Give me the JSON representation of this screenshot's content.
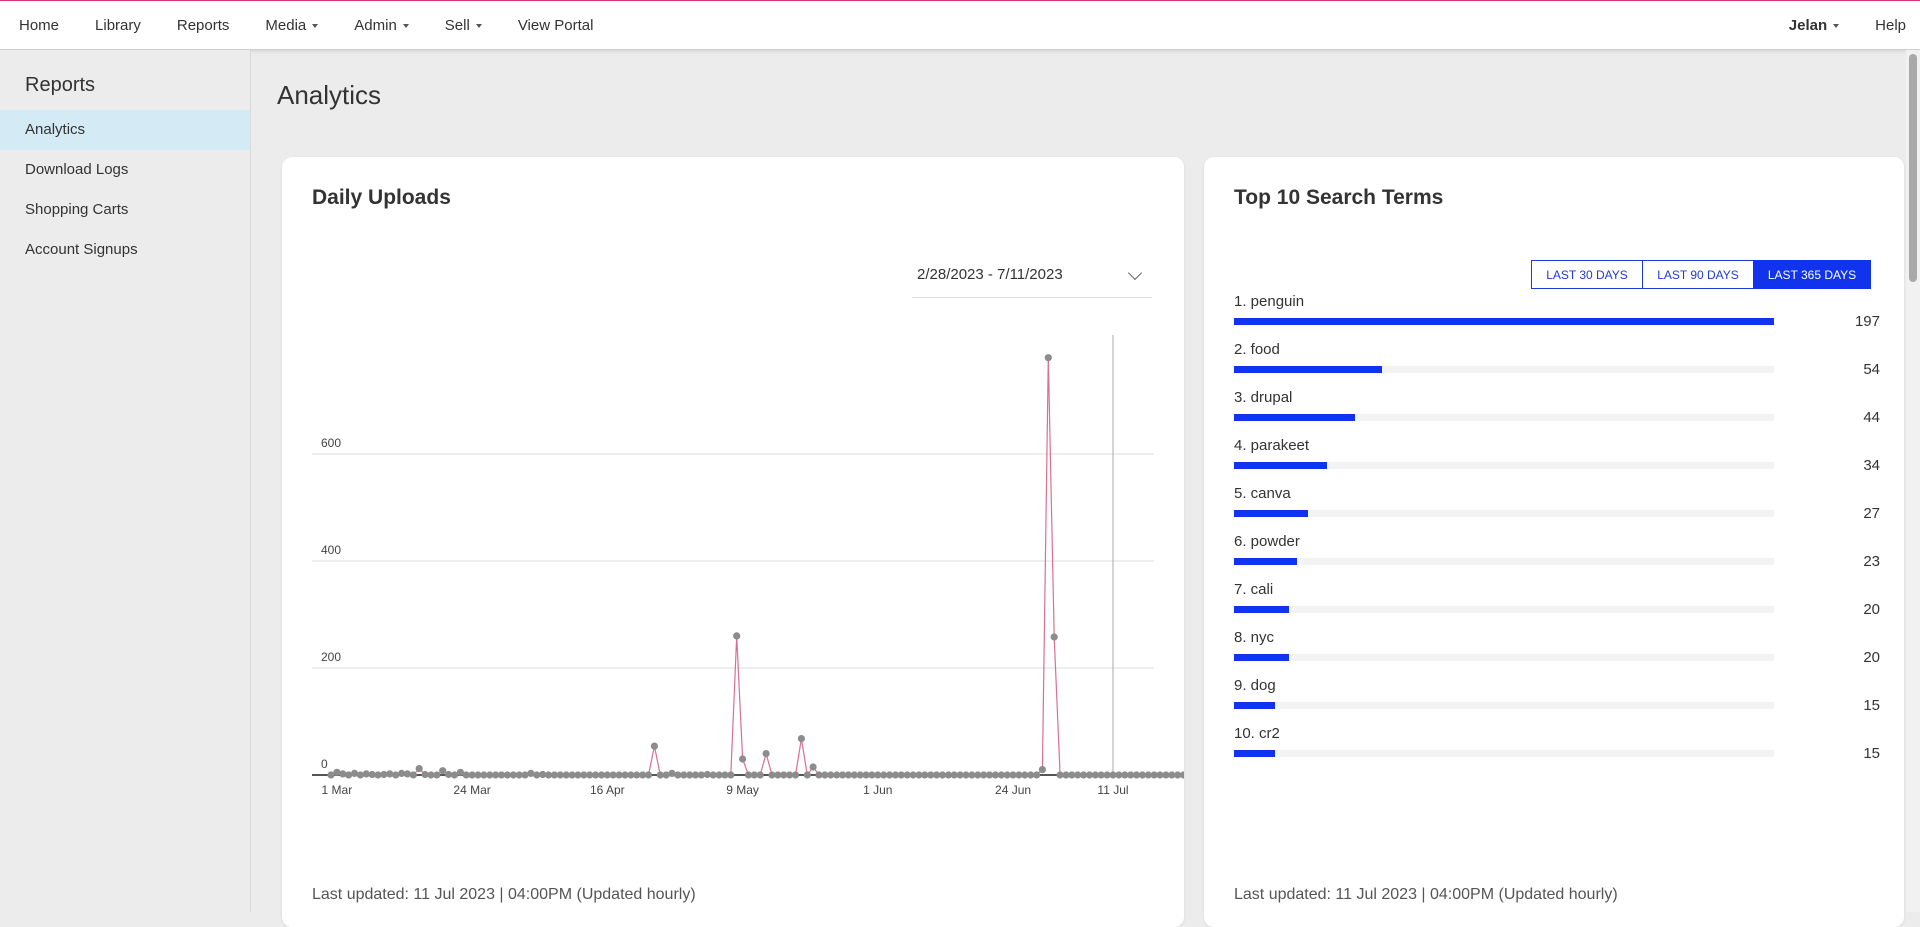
{
  "nav": {
    "items": [
      {
        "label": "Home",
        "dropdown": false
      },
      {
        "label": "Library",
        "dropdown": false
      },
      {
        "label": "Reports",
        "dropdown": false
      },
      {
        "label": "Media",
        "dropdown": true
      },
      {
        "label": "Admin",
        "dropdown": true
      },
      {
        "label": "Sell",
        "dropdown": true
      },
      {
        "label": "View Portal",
        "dropdown": false
      }
    ],
    "user": "Jelan",
    "help": "Help"
  },
  "sidebar": {
    "title": "Reports",
    "items": [
      {
        "label": "Analytics",
        "active": true
      },
      {
        "label": "Download Logs",
        "active": false
      },
      {
        "label": "Shopping Carts",
        "active": false
      },
      {
        "label": "Account Signups",
        "active": false
      }
    ]
  },
  "page": {
    "title": "Analytics"
  },
  "uploads": {
    "title": "Daily Uploads",
    "date_range": "2/28/2023 - 7/11/2023",
    "last_updated": "Last updated: 11 Jul 2023 | 04:00PM (Updated hourly)"
  },
  "search_terms": {
    "title": "Top 10 Search Terms",
    "ranges": [
      {
        "label": "LAST 30 DAYS",
        "active": false
      },
      {
        "label": "LAST 90 DAYS",
        "active": false
      },
      {
        "label": "LAST 365 DAYS",
        "active": true
      }
    ],
    "terms": [
      {
        "label": "1. penguin",
        "count": 197
      },
      {
        "label": "2. food",
        "count": 54
      },
      {
        "label": "3. drupal",
        "count": 44
      },
      {
        "label": "4. parakeet",
        "count": 34
      },
      {
        "label": "5. canva",
        "count": 27
      },
      {
        "label": "6. powder",
        "count": 23
      },
      {
        "label": "7. cali",
        "count": 20
      },
      {
        "label": "8. nyc",
        "count": 20
      },
      {
        "label": "9. dog",
        "count": 15
      },
      {
        "label": "10. cr2",
        "count": 15
      }
    ],
    "last_updated": "Last updated: 11 Jul 2023 | 04:00PM (Updated hourly)"
  },
  "colors": {
    "accent": "#1133ee",
    "line": "#d9708f",
    "point": "#8c8c8c",
    "top_border": "#d6337a"
  },
  "chart_data": {
    "type": "line",
    "title": "Daily Uploads",
    "xlabel": "",
    "ylabel": "",
    "x_start": "2023-02-28",
    "x_end": "2023-07-11",
    "ylim": [
      0,
      800
    ],
    "y_ticks": [
      0,
      200,
      400,
      600
    ],
    "x_ticks": [
      {
        "label": "1 Mar",
        "date": "2023-03-01"
      },
      {
        "label": "24 Mar",
        "date": "2023-03-24"
      },
      {
        "label": "16 Apr",
        "date": "2023-04-16"
      },
      {
        "label": "9 May",
        "date": "2023-05-09"
      },
      {
        "label": "1 Jun",
        "date": "2023-06-01"
      },
      {
        "label": "24 Jun",
        "date": "2023-06-24"
      },
      {
        "label": "11 Jul",
        "date": "2023-07-11"
      }
    ],
    "grid": true,
    "series": [
      {
        "values": [
          0,
          5,
          2,
          0,
          3,
          0,
          2,
          1,
          0,
          1,
          2,
          0,
          3,
          2,
          0,
          12,
          1,
          0,
          0,
          8,
          1,
          0,
          5,
          0,
          0,
          0,
          0,
          0,
          0,
          0,
          0,
          0,
          0,
          0,
          3,
          0,
          1,
          0,
          0,
          0,
          0,
          0,
          0,
          0,
          0,
          0,
          0,
          0,
          0,
          0,
          0,
          0,
          0,
          0,
          0,
          54,
          0,
          0,
          3,
          0,
          0,
          0,
          0,
          0,
          1,
          0,
          0,
          0,
          0,
          260,
          30,
          0,
          0,
          0,
          40,
          0,
          0,
          0,
          0,
          0,
          68,
          0,
          15,
          0,
          0,
          0,
          0,
          0,
          0,
          0,
          0,
          0,
          0,
          0,
          0,
          0,
          0,
          0,
          0,
          0,
          0,
          0,
          0,
          0,
          0,
          0,
          0,
          0,
          0,
          0,
          0,
          0,
          0,
          0,
          0,
          0,
          0,
          0,
          0,
          0,
          0,
          10,
          780,
          258,
          0,
          0,
          0,
          0,
          0,
          0,
          0,
          0,
          0,
          0,
          0,
          0,
          0,
          0,
          0,
          0,
          0,
          0,
          0,
          0,
          0,
          0,
          2,
          0,
          0,
          0,
          0,
          0,
          0,
          0,
          0,
          0,
          0,
          0,
          2,
          0,
          0,
          0,
          0
        ]
      }
    ]
  }
}
